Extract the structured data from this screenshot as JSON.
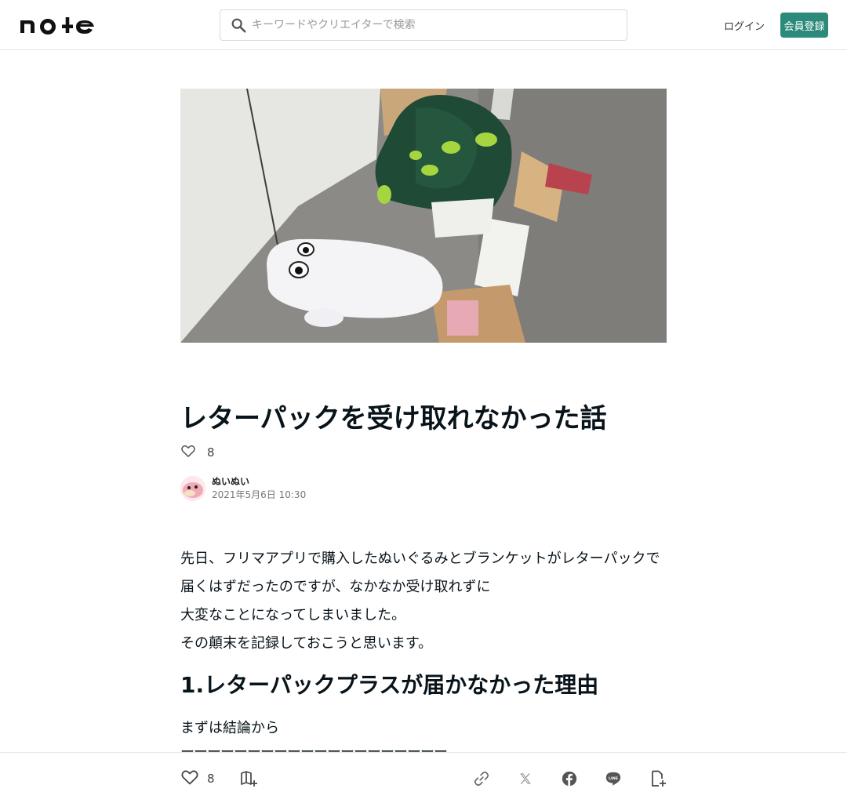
{
  "header": {
    "logo_text": "note",
    "search_placeholder": "キーワードやクリエイターで検索",
    "login_label": "ログイン",
    "signup_label": "会員登録",
    "accent_color": "#2b8a7a"
  },
  "article": {
    "title": "レターパックを受け取れなかった話",
    "like_count": "8",
    "author": {
      "name": "ぬいぬい",
      "date": "2021年5月6日 10:30"
    },
    "paragraphs": [
      "先日、フリマアプリで購入したぬいぐるみとブランケットがレターパックで届くはずだったのですが、なかなか受け取れずに",
      "大変なことになってしまいました。",
      "その顛末を記録しておこうと思います。"
    ],
    "heading": "1.レターパックプラスが届かなかった理由",
    "subheading": "まずは結論から",
    "separator": "ーーーーーーーーーーーーーーーーーーーー"
  },
  "bottom_bar": {
    "like_count": "8",
    "icons": [
      "heart-icon",
      "magazine-add-icon",
      "link-icon",
      "x-icon",
      "facebook-icon",
      "line-icon",
      "note-add-icon"
    ]
  }
}
